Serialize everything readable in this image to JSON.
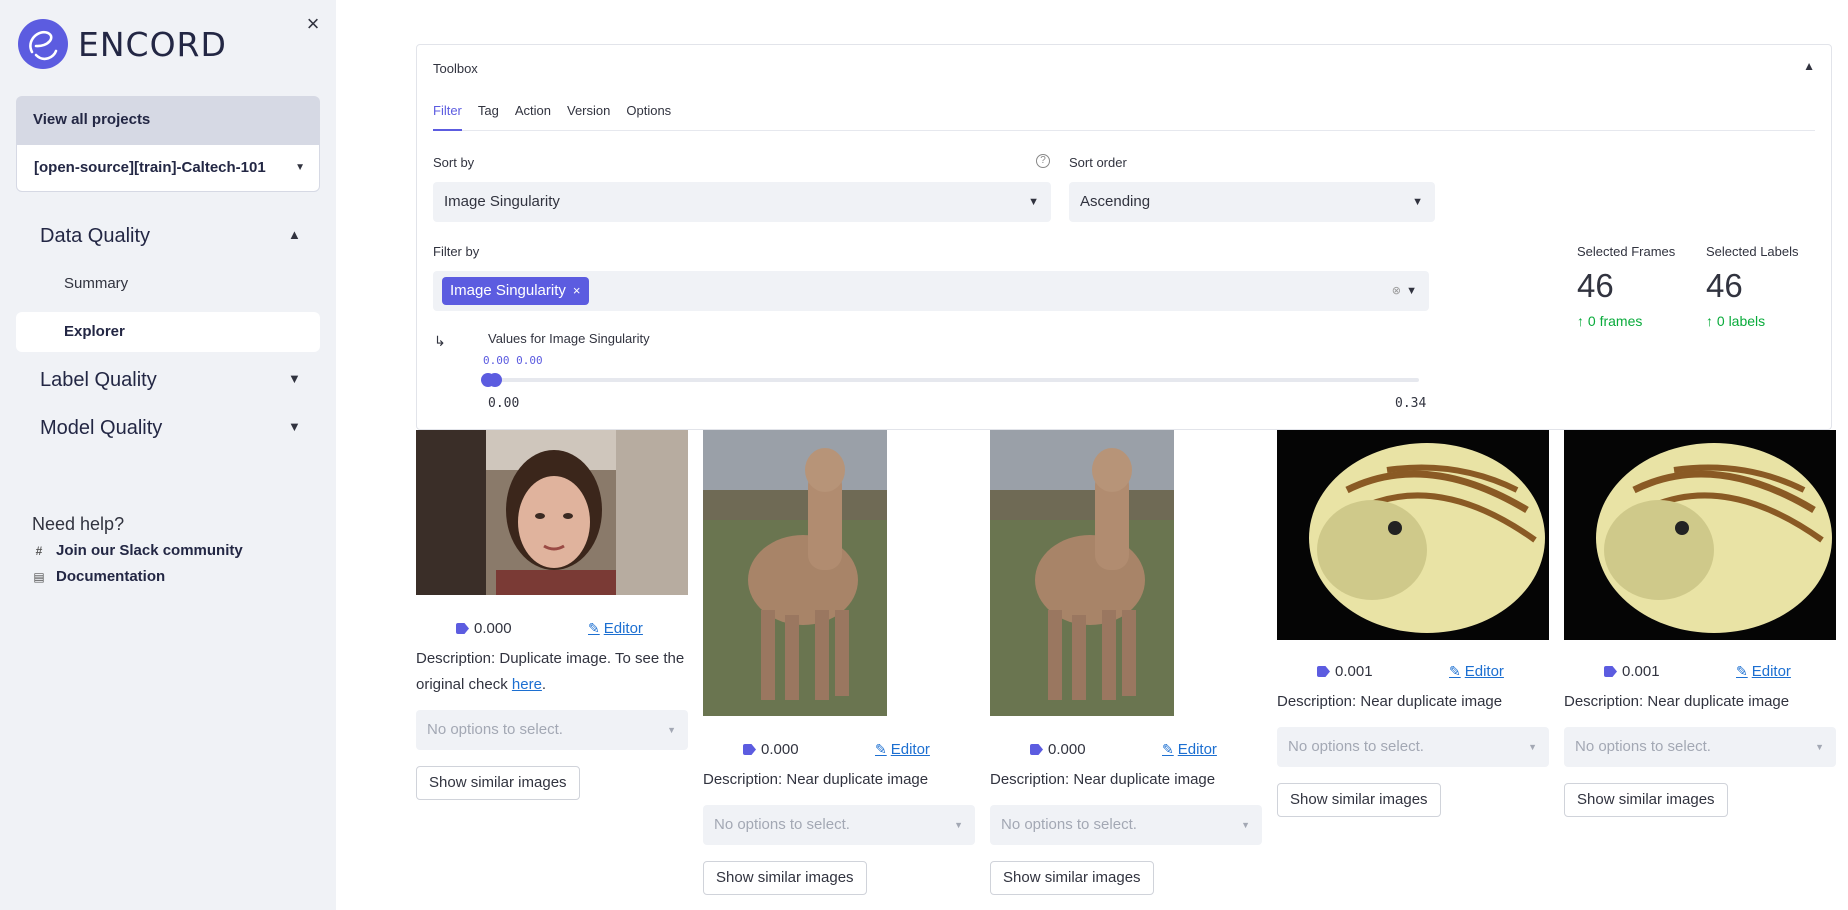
{
  "sidebar": {
    "logo_text": "ENCORD",
    "view_all": "View all projects",
    "project": "[open-source][train]-Caltech-101",
    "sections": [
      {
        "label": "Data Quality",
        "expanded": true
      },
      {
        "label": "Label Quality",
        "expanded": false
      },
      {
        "label": "Model Quality",
        "expanded": false
      }
    ],
    "sub_items": [
      "Summary",
      "Explorer"
    ],
    "help": {
      "title": "Need help?",
      "links": [
        "Join our Slack community",
        "Documentation"
      ]
    }
  },
  "toolbox": {
    "title": "Toolbox",
    "tabs": [
      "Filter",
      "Tag",
      "Action",
      "Version",
      "Options"
    ],
    "sort_by_label": "Sort by",
    "sort_by_value": "Image Singularity",
    "sort_order_label": "Sort order",
    "sort_order_value": "Ascending",
    "filter_by_label": "Filter by",
    "filter_chip": "Image Singularity",
    "values_label": "Values for Image Singularity",
    "range_readout": "0.00 0.00",
    "min": "0.00",
    "max": "0.34",
    "stats": {
      "frames_label": "Selected Frames",
      "frames_value": "46",
      "frames_delta": "0 frames",
      "labels_label": "Selected Labels",
      "labels_value": "46",
      "labels_delta": "0 labels"
    }
  },
  "cards": [
    {
      "score": "0.000",
      "editor": "Editor",
      "desc_prefix": "Description: Duplicate image. To see the original check ",
      "desc_link": "here",
      "desc_suffix": ".",
      "options": "No options to select.",
      "button": "Show similar images",
      "image": "portrait"
    },
    {
      "score": "0.000",
      "editor": "Editor",
      "desc_prefix": "Description: Near duplicate image",
      "desc_link": "",
      "desc_suffix": "",
      "options": "No options to select.",
      "button": "Show similar images",
      "image": "llama"
    },
    {
      "score": "0.000",
      "editor": "Editor",
      "desc_prefix": "Description: Near duplicate image",
      "desc_link": "",
      "desc_suffix": "",
      "options": "No options to select.",
      "button": "Show similar images",
      "image": "llama"
    },
    {
      "score": "0.001",
      "editor": "Editor",
      "desc_prefix": "Description: Near duplicate image",
      "desc_link": "",
      "desc_suffix": "",
      "options": "No options to select.",
      "button": "Show similar images",
      "image": "nautilus"
    },
    {
      "score": "0.001",
      "editor": "Editor",
      "desc_prefix": "Description: Near duplicate image",
      "desc_link": "",
      "desc_suffix": "",
      "options": "No options to select.",
      "button": "Show similar images",
      "image": "nautilus"
    }
  ],
  "colors": {
    "accent": "#5c5ce0",
    "link": "#1c6fd1",
    "positive": "#09ab3b",
    "sidebar_bg": "#f0f2f6"
  }
}
